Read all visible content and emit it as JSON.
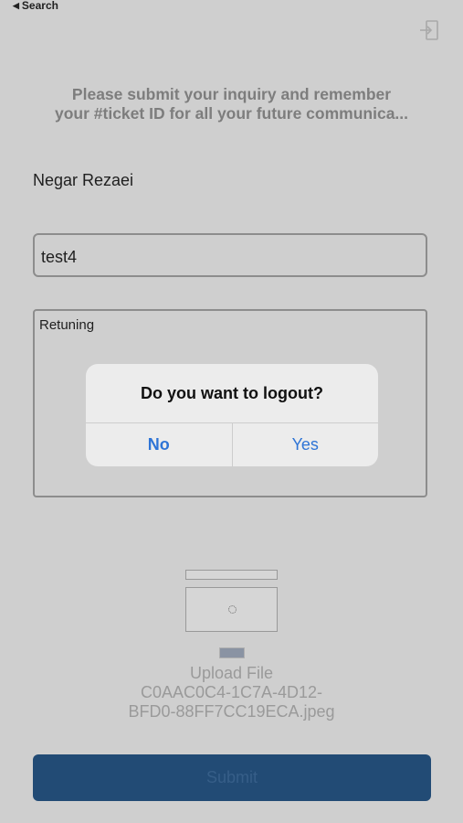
{
  "status_bar": {
    "back_label": "Search"
  },
  "header": {
    "line1": "Please submit your inquiry and remember",
    "line2": "your #ticket ID for all your future communica..."
  },
  "user": {
    "name": "Negar Rezaei"
  },
  "form": {
    "title_value": "test4",
    "description_value": "Retuning",
    "upload_label_line1": "Upload File",
    "upload_label_line2": "C0AAC0C4-1C7A-4D12-",
    "upload_label_line3": "BFD0-88FF7CC19ECA.jpeg",
    "submit_label": "Submit"
  },
  "dialog": {
    "title": "Do you want to logout?",
    "no_label": "No",
    "yes_label": "Yes"
  },
  "colors": {
    "accent": "#2e74d6",
    "submit_bg": "#224b75"
  }
}
